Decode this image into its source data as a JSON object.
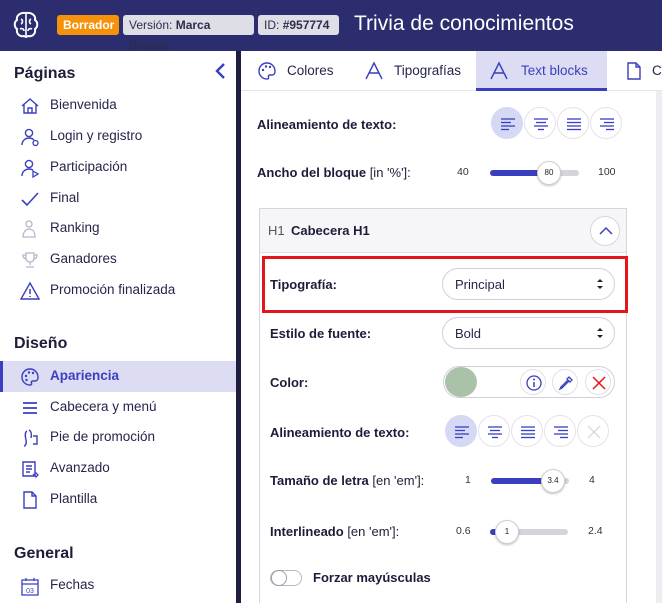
{
  "header": {
    "draft_badge": "Borrador",
    "version_label": "Versión:",
    "version_value": "Marca Blanca",
    "id_label": "ID:",
    "id_value": "#957774",
    "title": "Trivia de conocimientos",
    "colors": {
      "bg": "#2b2d6e",
      "draft": "#f5920a"
    }
  },
  "sidebar": {
    "sections": [
      {
        "title": "Páginas"
      },
      {
        "title": "Diseño"
      },
      {
        "title": "General"
      }
    ],
    "pages": [
      {
        "label": "Bienvenida",
        "icon": "home-icon"
      },
      {
        "label": "Login y registro",
        "icon": "user-icon"
      },
      {
        "label": "Participación",
        "icon": "user-play-icon"
      },
      {
        "label": "Final",
        "icon": "check-icon"
      },
      {
        "label": "Ranking",
        "icon": "ranking-icon"
      },
      {
        "label": "Ganadores",
        "icon": "trophy-icon"
      },
      {
        "label": "Promoción finalizada",
        "icon": "warning-icon"
      }
    ],
    "design": [
      {
        "label": "Apariencia",
        "icon": "palette-icon",
        "active": true
      },
      {
        "label": "Cabecera y menú",
        "icon": "menu-icon"
      },
      {
        "label": "Pie de promoción",
        "icon": "footer-icon"
      },
      {
        "label": "Avanzado",
        "icon": "advanced-icon"
      },
      {
        "label": "Plantilla",
        "icon": "file-icon"
      }
    ],
    "general": [
      {
        "label": "Fechas",
        "icon": "calendar-icon",
        "calendar_day": "03"
      }
    ]
  },
  "tabs": [
    {
      "label": "Colores",
      "icon": "palette-icon"
    },
    {
      "label": "Tipografías",
      "icon": "font-icon"
    },
    {
      "label": "Text blocks",
      "icon": "font-icon",
      "active": true
    },
    {
      "label": "C",
      "icon": "file-icon"
    }
  ],
  "block": {
    "align_label": "Alineamiento de texto:",
    "width_label": "Ancho del bloque",
    "width_unit": "[in '%']:",
    "width_slider": {
      "min": "40",
      "max": "100",
      "value": "80",
      "fraction": 0.67
    }
  },
  "h1": {
    "tag": "H1",
    "name": "Cabecera H1",
    "typography_label": "Tipografía:",
    "typography_value": "Principal",
    "font_style_label": "Estilo de fuente:",
    "font_style_value": "Bold",
    "color_label": "Color:",
    "color_value": "#a9c2a8",
    "align_label": "Alineamiento de texto:",
    "font_size_label": "Tamaño de letra",
    "font_size_unit": "[en 'em']:",
    "font_size_slider": {
      "min": "1",
      "max": "4",
      "value": "3.4",
      "fraction": 0.8
    },
    "line_height_label": "Interlineado",
    "line_height_unit": "[en 'em']:",
    "line_height_slider": {
      "min": "0.6",
      "max": "2.4",
      "value": "1",
      "fraction": 0.22
    },
    "uppercase_label": "Forzar mayúsculas",
    "uppercase_on": false
  },
  "accent_color": "#3a3fbf",
  "highlight_color": "#e3161b"
}
